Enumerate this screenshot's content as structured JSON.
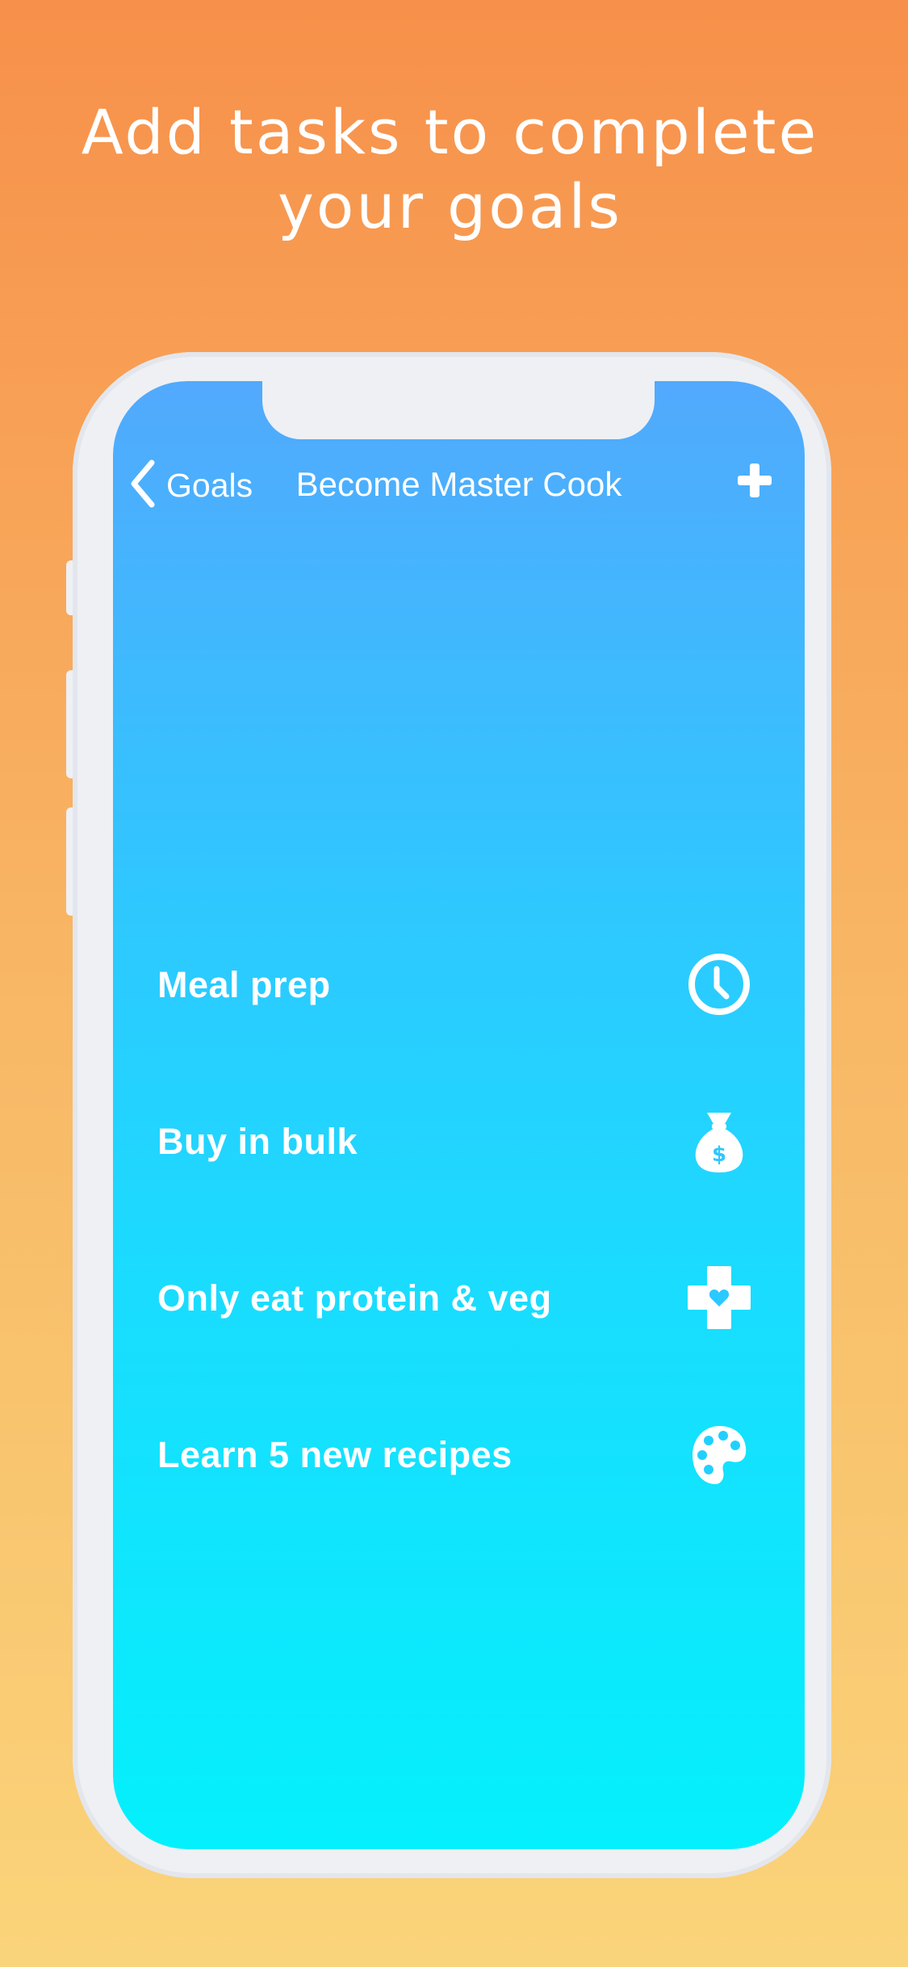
{
  "headline": {
    "line1": "Add tasks to complete",
    "line2": "your goals"
  },
  "nav": {
    "back_label": "Goals",
    "title": "Become Master Cook",
    "back_icon": "chevron-left-icon",
    "add_icon": "plus-icon"
  },
  "tasks": [
    {
      "label": "Meal prep",
      "icon": "clock-icon"
    },
    {
      "label": "Buy in bulk",
      "icon": "money-bag-icon"
    },
    {
      "label": "Only eat protein & veg",
      "icon": "health-cross-icon"
    },
    {
      "label": "Learn 5 new recipes",
      "icon": "palette-icon"
    }
  ],
  "colors": {
    "background_top": "#F7904A",
    "background_bottom": "#FAD47A",
    "screen_top": "#52A9FD",
    "screen_bottom": "#04F0FC",
    "text": "#FFFFFF"
  }
}
